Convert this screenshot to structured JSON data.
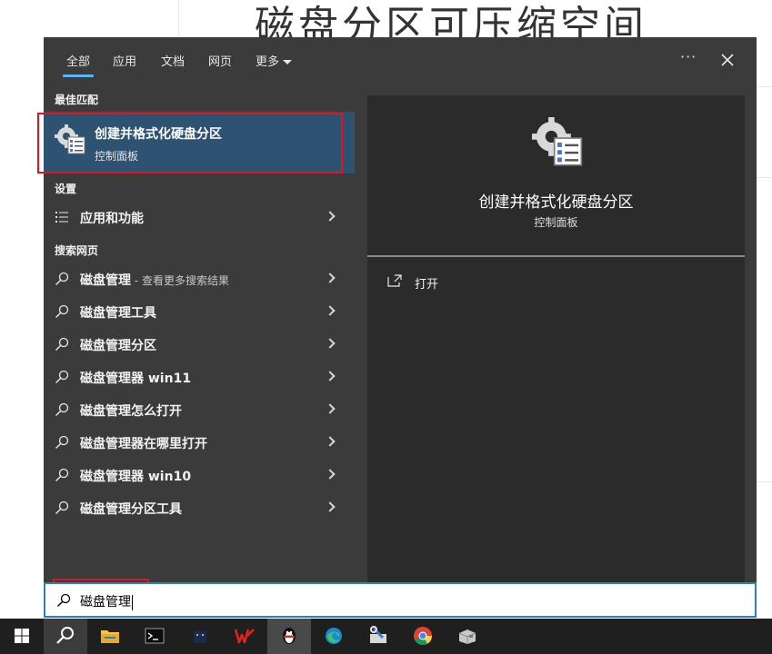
{
  "background": {
    "doc_title": "磁盘分区可压缩空间"
  },
  "tabs": [
    {
      "label": "全部"
    },
    {
      "label": "应用"
    },
    {
      "label": "文档"
    },
    {
      "label": "网页"
    },
    {
      "label": "更多"
    }
  ],
  "header": {
    "more_options": "···"
  },
  "sections": {
    "best_match": "最佳匹配",
    "settings": "设置",
    "web_search": "搜索网页"
  },
  "best_match": {
    "title": "创建并格式化硬盘分区",
    "subtitle": "控制面板",
    "icon": "control-panel-gear-icon"
  },
  "settings_items": [
    {
      "label": "应用和功能",
      "icon": "list-icon"
    }
  ],
  "web_results": [
    {
      "label": "磁盘管理",
      "suffix": " - 查看更多搜索结果"
    },
    {
      "label": "磁盘管理工具",
      "suffix": ""
    },
    {
      "label": "磁盘管理分区",
      "suffix": ""
    },
    {
      "label": "磁盘管理器 win11",
      "suffix": ""
    },
    {
      "label": "磁盘管理怎么打开",
      "suffix": ""
    },
    {
      "label": "磁盘管理器在哪里打开",
      "suffix": ""
    },
    {
      "label": "磁盘管理器 win10",
      "suffix": ""
    },
    {
      "label": "磁盘管理分区工具",
      "suffix": ""
    }
  ],
  "preview": {
    "title": "创建并格式化硬盘分区",
    "subtitle": "控制面板",
    "actions": [
      {
        "label": "打开",
        "icon": "open-external-icon"
      }
    ]
  },
  "search": {
    "value": "磁盘管理"
  },
  "taskbar": {
    "items": [
      "windows-start",
      "search",
      "file-explorer",
      "terminal",
      "app-dark",
      "wps",
      "qq",
      "edge",
      "tool-app",
      "chrome",
      "package-app"
    ]
  },
  "colors": {
    "panel_bg": "#3b3b3b",
    "preview_bg": "#2b2b2b",
    "selected_bg": "#2e5272",
    "accent": "#5cb4f5",
    "highlight_box": "#e0141c",
    "taskbar_bg": "#1f1f1f"
  }
}
